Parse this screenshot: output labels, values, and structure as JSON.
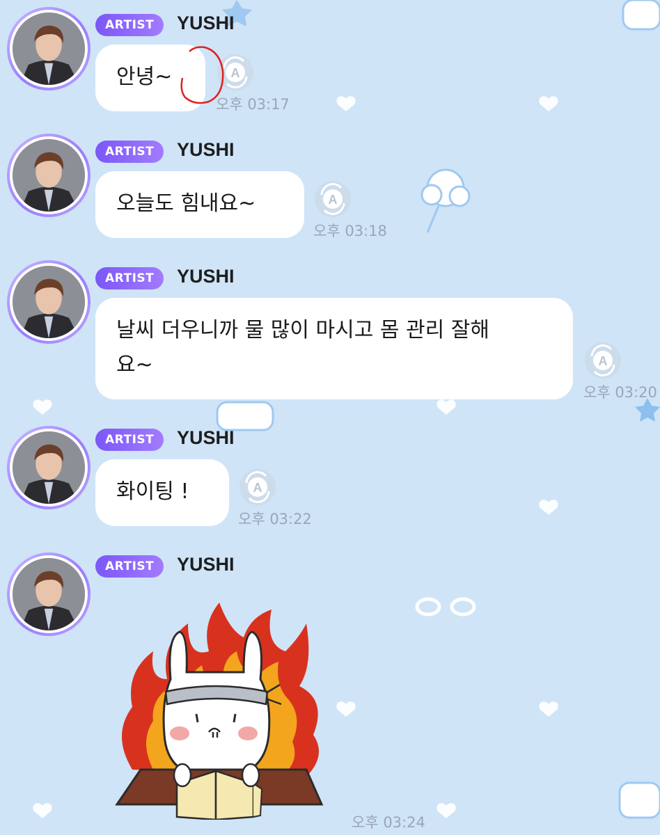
{
  "colors": {
    "background": "#cfe4f7",
    "badge_gradient_start": "#7b57f7",
    "badge_gradient_end": "#a37bff",
    "bubble": "#ffffff",
    "timestamp": "#9aa6b4",
    "annotation_circle": "#e02020"
  },
  "messages": [
    {
      "badge": "ARTIST",
      "sender": "YUSHI",
      "text": "안녕~",
      "time": "오후 03:17",
      "translate_icon": "translate-icon"
    },
    {
      "badge": "ARTIST",
      "sender": "YUSHI",
      "text": "오늘도 힘내요~",
      "time": "오후 03:18",
      "translate_icon": "translate-icon"
    },
    {
      "badge": "ARTIST",
      "sender": "YUSHI",
      "text_line1": "날씨 더우니까 물 많이 마시고 몸 관리 잘해",
      "text_line2": "요~",
      "time": "오후 03:20",
      "translate_icon": "translate-icon"
    },
    {
      "badge": "ARTIST",
      "sender": "YUSHI",
      "text": "화이팅 !",
      "time": "오후 03:22",
      "translate_icon": "translate-icon"
    },
    {
      "badge": "ARTIST",
      "sender": "YUSHI",
      "sticker": "fire-bunny-studying-sticker",
      "time": "오후 03:24"
    }
  ]
}
